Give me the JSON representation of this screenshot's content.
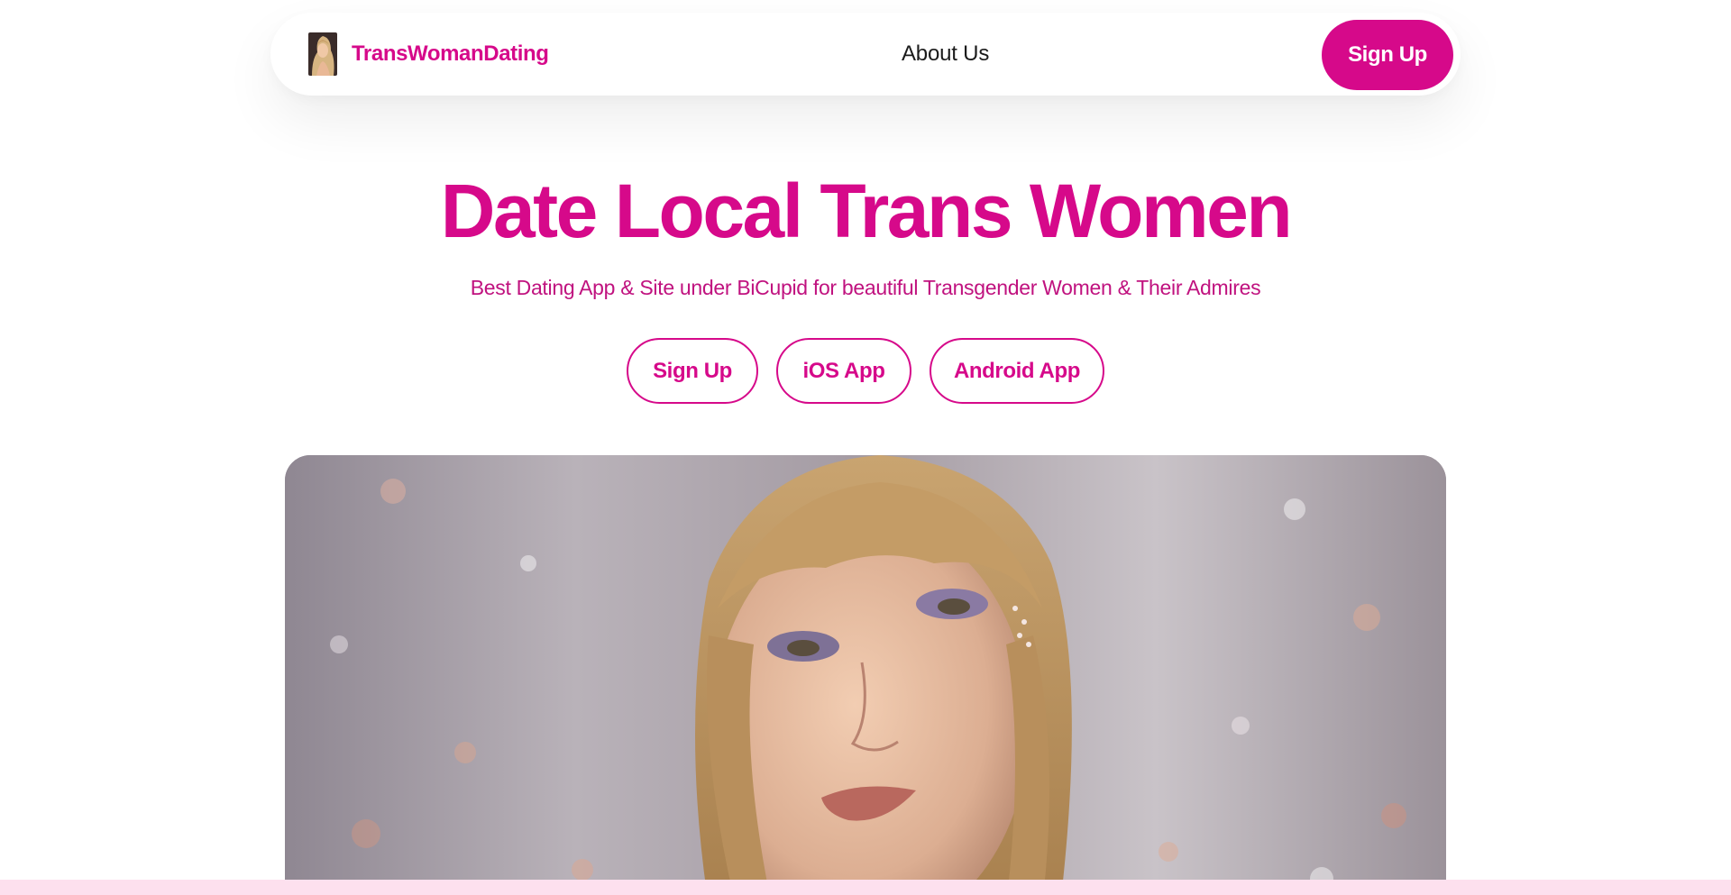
{
  "header": {
    "brand_name": "TransWomanDating",
    "brand_logo": "profile-photo-logo",
    "about_label": "About Us",
    "signup_label": "Sign Up"
  },
  "hero": {
    "title": "Date Local Trans Women",
    "subtitle": "Best Dating App & Site under BiCupid for beautiful Transgender Women & Their Admires",
    "buttons": {
      "signup": "Sign Up",
      "ios": "iOS App",
      "android": "Android App"
    },
    "image": "woman-portrait-photo"
  },
  "colors": {
    "brand": "#d6098a",
    "subtitle": "#c0127f",
    "band": "#fde0ee"
  }
}
